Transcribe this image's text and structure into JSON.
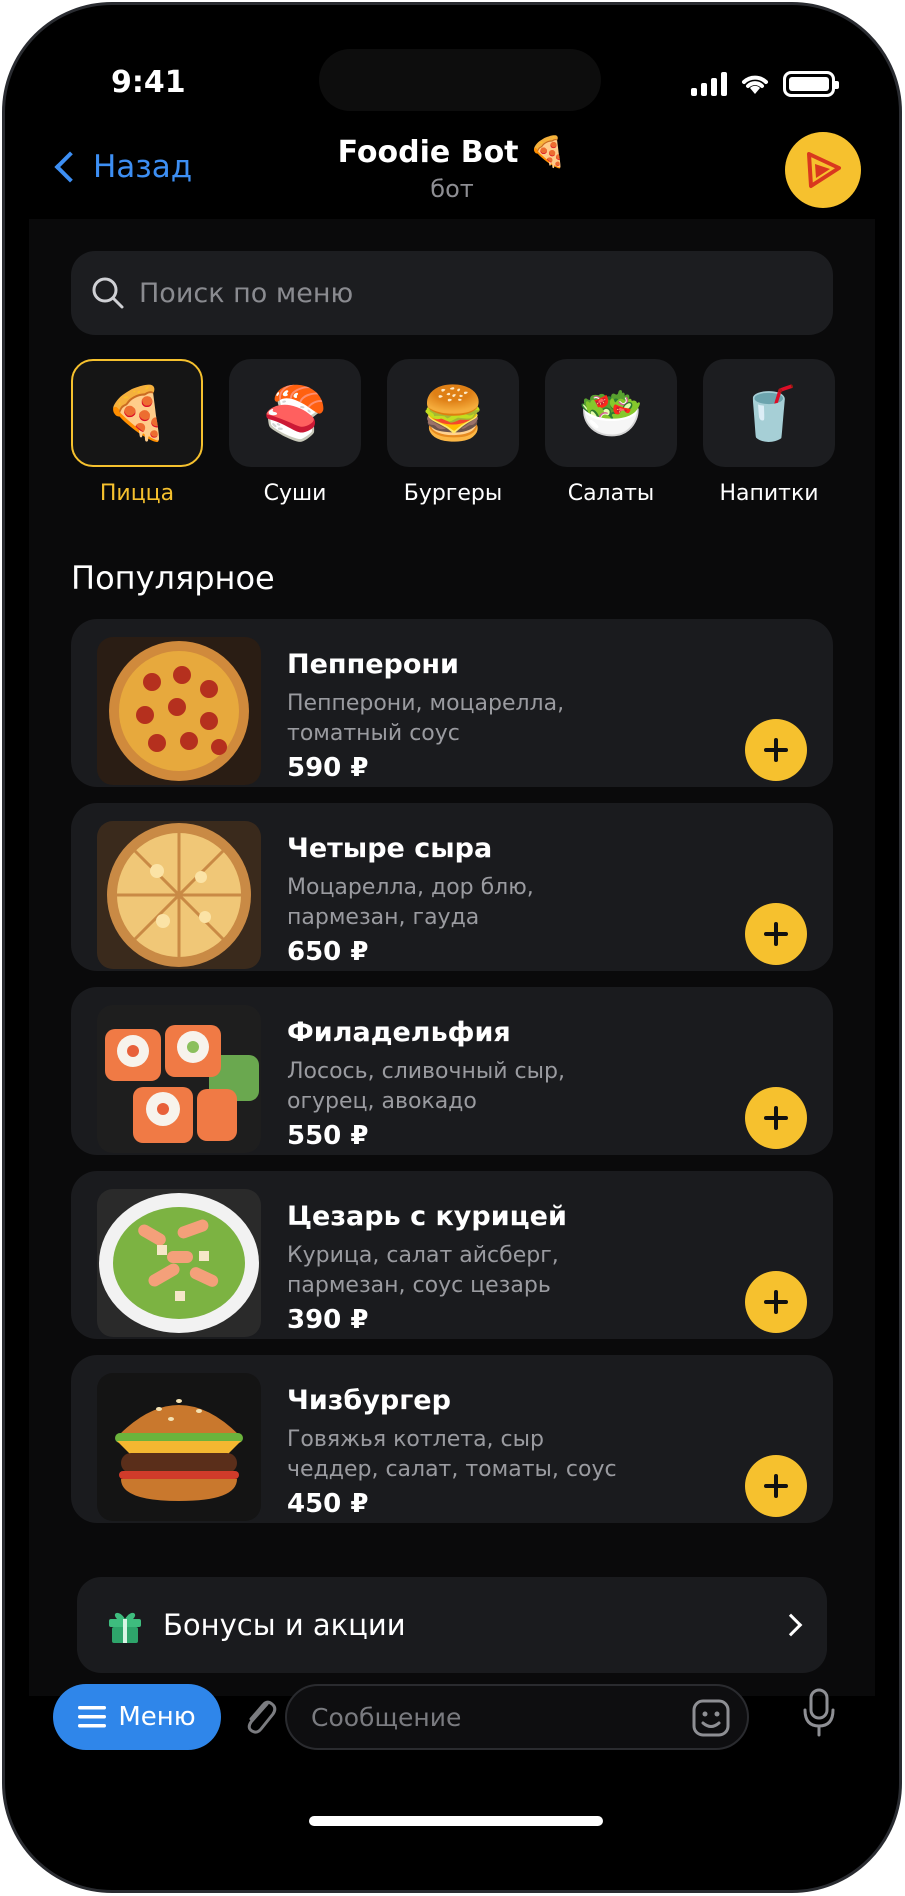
{
  "status_bar": {
    "time": "9:41"
  },
  "header": {
    "back_label": "Назад",
    "title": "Foodie Bot 🍕",
    "subtitle": "бот"
  },
  "search": {
    "placeholder": "Поиск по меню"
  },
  "categories": [
    {
      "label": "Пицца",
      "emoji": "🍕",
      "active": true
    },
    {
      "label": "Суши",
      "emoji": "🍣",
      "active": false
    },
    {
      "label": "Бургеры",
      "emoji": "🍔",
      "active": false
    },
    {
      "label": "Салаты",
      "emoji": "🥗",
      "active": false
    },
    {
      "label": "Напитки",
      "emoji": "🥤",
      "active": false
    }
  ],
  "section_title": "Популярное",
  "items": [
    {
      "name": "Пепперони",
      "description": "Пепперони, моцарелла, томатный соус",
      "price": "590 ₽"
    },
    {
      "name": "Четыре сыра",
      "description": "Моцарелла, дор блю, пармезан, гауда",
      "price": "650 ₽"
    },
    {
      "name": "Филадельфия",
      "description": "Лосось, сливочный сыр, огурец, авокадо",
      "price": "550 ₽"
    },
    {
      "name": "Цезарь с курицей",
      "description": "Курица, салат айсберг, пармезан, соус цезарь",
      "price": "390 ₽"
    },
    {
      "name": "Чизбургер",
      "description": "Говяжья котлета, сыр чеддер, салат, томаты, соус",
      "price": "450 ₽"
    }
  ],
  "bonus": {
    "label": "Бонусы и акции"
  },
  "input_bar": {
    "menu_label": "Меню",
    "message_placeholder": "Сообщение"
  },
  "colors": {
    "accent": "#f6c12e",
    "link": "#3d8ff4",
    "menu_button": "#2f86ea",
    "card": "#1a1b1e"
  }
}
